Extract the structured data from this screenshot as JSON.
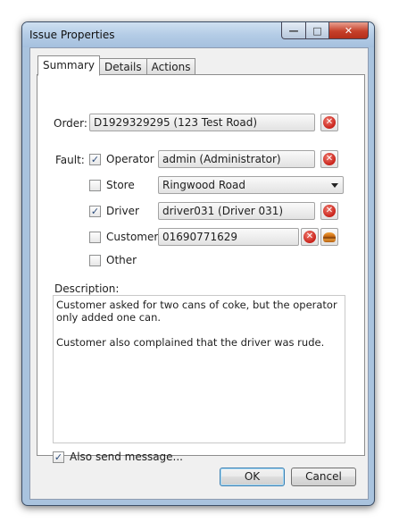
{
  "window": {
    "title": "Issue Properties"
  },
  "tabs": [
    {
      "label": "Summary"
    },
    {
      "label": "Details"
    },
    {
      "label": "Actions"
    }
  ],
  "order": {
    "label": "Order:",
    "value": "D1929329295 (123 Test Road)"
  },
  "fault": {
    "label": "Fault:",
    "rows": [
      {
        "label": "Operator",
        "checked": true,
        "value": "admin (Administrator)"
      },
      {
        "label": "Store",
        "checked": false,
        "value": "Ringwood Road"
      },
      {
        "label": "Driver",
        "checked": true,
        "value": "driver031 (Driver 031)"
      },
      {
        "label": "Customer",
        "checked": false,
        "value": "01690771629"
      },
      {
        "label": "Other",
        "checked": false
      }
    ]
  },
  "description": {
    "label": "Description:",
    "text": "Customer asked for two cans of coke, but the operator only added one can.\n\nCustomer also complained that the driver was rude."
  },
  "also_send": {
    "label": "Also send message...",
    "checked": true
  },
  "buttons": {
    "ok": "OK",
    "cancel": "Cancel"
  },
  "icons": {
    "clear": "clear-x-icon",
    "lookup": "burger-icon",
    "dropdown": "chevron-down-icon"
  },
  "colors": {
    "clear_red": "#c9221a",
    "title_bar": "#b4cce6",
    "default_button": "#3c7fb1"
  }
}
